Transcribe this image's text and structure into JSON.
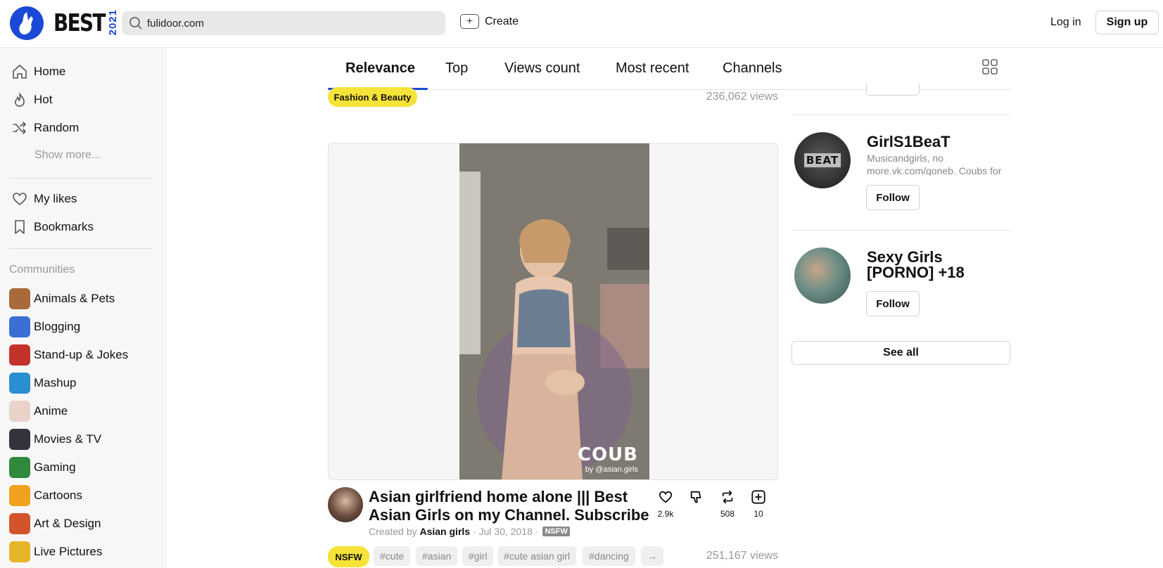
{
  "header": {
    "logo_text": "BEST",
    "logo_year": "2021",
    "search_value": "fulidoor.com",
    "create_label": "Create",
    "login_label": "Log in",
    "signup_label": "Sign up"
  },
  "sidebar": {
    "nav": [
      {
        "label": "Home",
        "icon": "home-icon"
      },
      {
        "label": "Hot",
        "icon": "flame-icon"
      },
      {
        "label": "Random",
        "icon": "shuffle-icon"
      }
    ],
    "show_more": "Show more...",
    "personal": [
      {
        "label": "My likes",
        "icon": "heart-icon"
      },
      {
        "label": "Bookmarks",
        "icon": "bookmark-icon"
      }
    ],
    "communities_title": "Communities",
    "communities": [
      {
        "label": "Animals & Pets",
        "color": "#a86a3a"
      },
      {
        "label": "Blogging",
        "color": "#3b6fd4"
      },
      {
        "label": "Stand-up & Jokes",
        "color": "#c2332b"
      },
      {
        "label": "Mashup",
        "color": "#2a8fd0"
      },
      {
        "label": "Anime",
        "color": "#e9d3c9"
      },
      {
        "label": "Movies & TV",
        "color": "#333340"
      },
      {
        "label": "Gaming",
        "color": "#2f8a3c"
      },
      {
        "label": "Cartoons",
        "color": "#f0a21e"
      },
      {
        "label": "Art & Design",
        "color": "#d2542a"
      },
      {
        "label": "Live Pictures",
        "color": "#e6b52a"
      }
    ]
  },
  "tabs": [
    {
      "label": "Relevance",
      "active": true
    },
    {
      "label": "Top",
      "active": false
    },
    {
      "label": "Views count",
      "active": false
    },
    {
      "label": "Most recent",
      "active": false
    },
    {
      "label": "Channels",
      "active": false
    }
  ],
  "prev_post": {
    "category": "Fashion & Beauty",
    "views": "236,062 views"
  },
  "post": {
    "watermark": "COUB",
    "watermark_by": "by @asian.girls",
    "title": "Asian girlfriend home alone ||| Best Asian Girls on my Channel. Subscribe",
    "created_by_label": "Created by",
    "author": "Asian girls",
    "date": "· Jul 30, 2018 ·",
    "nsfw_badge": "NSFW",
    "likes": "2.9k",
    "recoubs": "508",
    "bookmarks": "10",
    "tags": [
      "NSFW",
      "#cute",
      "#asian",
      "#girl",
      "#cute asian girl",
      "#dancing",
      "→"
    ],
    "views": "251,167 views"
  },
  "channels": [
    {
      "name": "GirlS1BeaT",
      "description": "Musicandgirls, no more.vk.com/qoneb. Coubs for",
      "follow_label": "Follow",
      "avatar_text": "BEAT"
    },
    {
      "name": "Sexy Girls [PORNO] +18",
      "follow_label": "Follow"
    }
  ],
  "see_all_label": "See all"
}
